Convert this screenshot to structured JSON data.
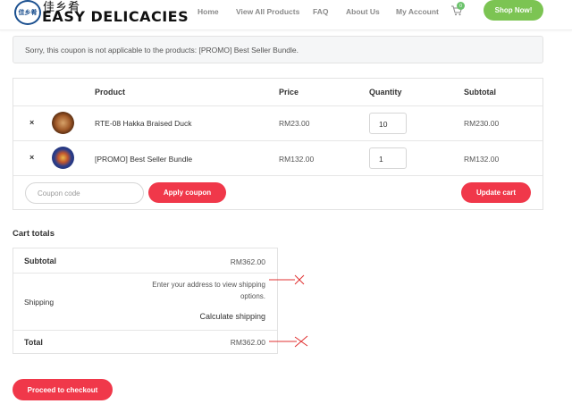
{
  "header": {
    "logo_mark": "佳乡肴",
    "logo_cn": "佳乡肴",
    "logo_text": "EASY DELICACIES",
    "nav": [
      "Home",
      "View All Products",
      "FAQ",
      "About Us",
      "My Account"
    ],
    "cart_count": "0",
    "shop_button": "Shop Now!"
  },
  "notice": "Sorry, this coupon is not applicable to the products: [PROMO] Best Seller Bundle.",
  "cart": {
    "headers": {
      "product": "Product",
      "price": "Price",
      "quantity": "Quantity",
      "subtotal": "Subtotal"
    },
    "items": [
      {
        "remove": "×",
        "name": "RTE-08 Hakka Braised Duck",
        "price": "RM23.00",
        "quantity": "10",
        "subtotal": "RM230.00"
      },
      {
        "remove": "×",
        "name": "[PROMO] Best Seller Bundle",
        "price": "RM132.00",
        "quantity": "1",
        "subtotal": "RM132.00"
      }
    ],
    "coupon_placeholder": "Coupon code",
    "apply_button": "Apply coupon",
    "update_button": "Update cart"
  },
  "totals": {
    "title": "Cart totals",
    "subtotal_label": "Subtotal",
    "subtotal_value": "RM362.00",
    "shipping_label": "Shipping",
    "shipping_text": "Enter your address to view shipping options.",
    "calculate_shipping": "Calculate shipping",
    "total_label": "Total",
    "total_value": "RM362.00"
  },
  "checkout_button": "Proceed to checkout",
  "colors": {
    "accent_red": "#f0384a",
    "shop_green": "#7cc453"
  }
}
